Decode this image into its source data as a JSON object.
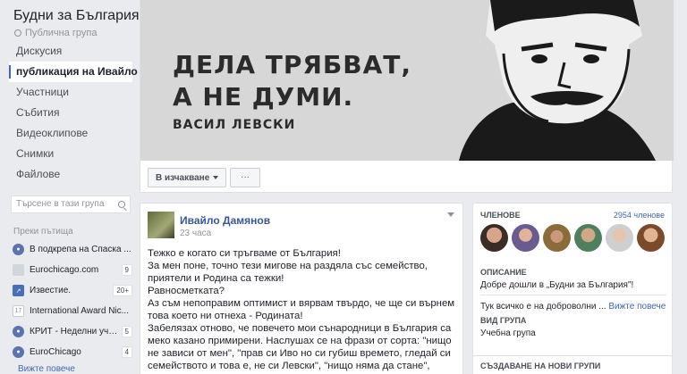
{
  "group": {
    "title": "Будни за България",
    "privacy": "Публична група"
  },
  "nav": {
    "items": [
      {
        "label": "Дискусия",
        "active": false
      },
      {
        "label": "публикация на Ивайло",
        "active": true
      },
      {
        "label": "Участници",
        "active": false
      },
      {
        "label": "Събития",
        "active": false
      },
      {
        "label": "Видеоклипове",
        "active": false
      },
      {
        "label": "Снимки",
        "active": false
      },
      {
        "label": "Файлове",
        "active": false
      }
    ]
  },
  "search": {
    "placeholder": "Търсене в тази група"
  },
  "shortcuts": {
    "heading": "Преки пътища",
    "items": [
      {
        "label": "В подкрепа на Спаска ...",
        "count": "",
        "icon": "group-icon",
        "color": "#5b73b0"
      },
      {
        "label": "Eurochicago.com",
        "count": "9",
        "icon": "page-icon",
        "color": "#d1d5dc"
      },
      {
        "label": "Известие.",
        "count": "20+",
        "icon": "chart-icon",
        "color": "#4a6fb5"
      },
      {
        "label": "International Award Nic...",
        "count": "",
        "icon": "calendar-icon",
        "color": "#c8ccd2"
      },
      {
        "label": "КРИТ - Неделни учи...",
        "count": "5",
        "icon": "group-icon",
        "color": "#5b73b0"
      },
      {
        "label": "EuroChicago",
        "count": "4",
        "icon": "group-icon",
        "color": "#5b73b0"
      }
    ],
    "see_more": "Вижте повече"
  },
  "cover": {
    "line1": "ДЕЛА ТРЯБВАТ,",
    "line2": "А НЕ ДУМИ.",
    "author": "ВАСИЛ ЛЕВСКИ",
    "joined_label": "В изчакване",
    "more_label": "···"
  },
  "post": {
    "author": "Ивайло Дамянов",
    "time": "23 часа",
    "paragraphs": [
      "Тежко е когато си тръгваме от България!",
      "За мен поне, точно тези мигове на раздяла със семейство, приятели и Родина са тежки!",
      "Равносметката?",
      "Аз съм непоправим оптимист и вярвам твърдо, че ще си върнем това което ни отнеха - Родината!",
      "Забелязах отново, че повечето мои сънародници в България са меко казано примирени. Наслушах се на фрази от сорта: \"нищо не зависи от мен\", \"прав си Иво но си губиш времето, гледай си семейството и това е, не си Левски\", \"нищо няма да стане\", \"всички са маскари но тия поне"
    ]
  },
  "about": {
    "members_heading": "ЧЛЕНОВЕ",
    "members_count": "2954 членове",
    "description_heading": "ОПИСАНИЕ",
    "description": "Добре дошли в „Будни за България\"!",
    "description2": "Тук всичко е на доброволни ...",
    "see_more": "Вижте повече",
    "type_heading": "ВИД ГРУПА",
    "type": "Учебна група"
  },
  "create_groups": {
    "heading": "СЪЗДАВАНЕ НА НОВИ ГРУПИ"
  },
  "colors": {
    "accent": "#4267b2",
    "link": "#365899",
    "bg": "#e9ebee"
  }
}
